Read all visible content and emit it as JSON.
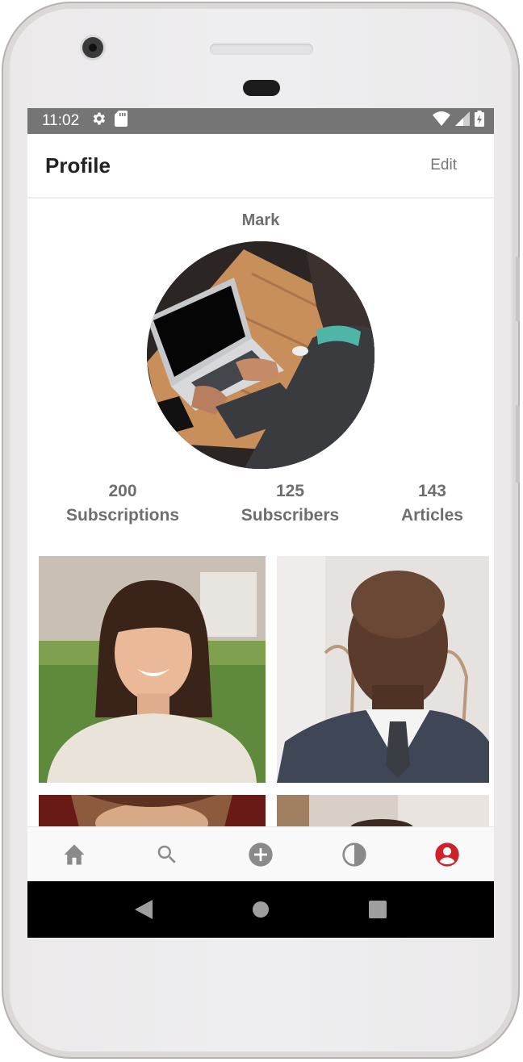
{
  "status_bar": {
    "time": "11:02",
    "left_icons": [
      "gear-icon",
      "sd-card-icon"
    ],
    "right_icons": [
      "wifi-icon",
      "signal-icon",
      "battery-charging-icon"
    ]
  },
  "app_bar": {
    "title": "Profile",
    "edit_label": "Edit"
  },
  "profile": {
    "name": "Mark",
    "avatar": "laptop-photo",
    "stats": [
      {
        "value": "200",
        "label": "Subscriptions"
      },
      {
        "value": "125",
        "label": "Subscribers"
      },
      {
        "value": "143",
        "label": "Articles"
      }
    ]
  },
  "grid": {
    "items": [
      "woman-portrait-photo",
      "man-in-suit-photo",
      "woman-red-hair-photo",
      "person-photo"
    ]
  },
  "bottom_nav": {
    "items": [
      {
        "icon": "home-icon",
        "active": false
      },
      {
        "icon": "search-icon",
        "active": false
      },
      {
        "icon": "add-circle-icon",
        "active": false
      },
      {
        "icon": "contrast-icon",
        "active": false
      },
      {
        "icon": "account-icon",
        "active": true
      }
    ],
    "inactive_color": "#8a8a8a",
    "active_color": "#d0202a"
  },
  "system_nav": [
    "back-icon",
    "home-circle-icon",
    "recents-icon"
  ]
}
